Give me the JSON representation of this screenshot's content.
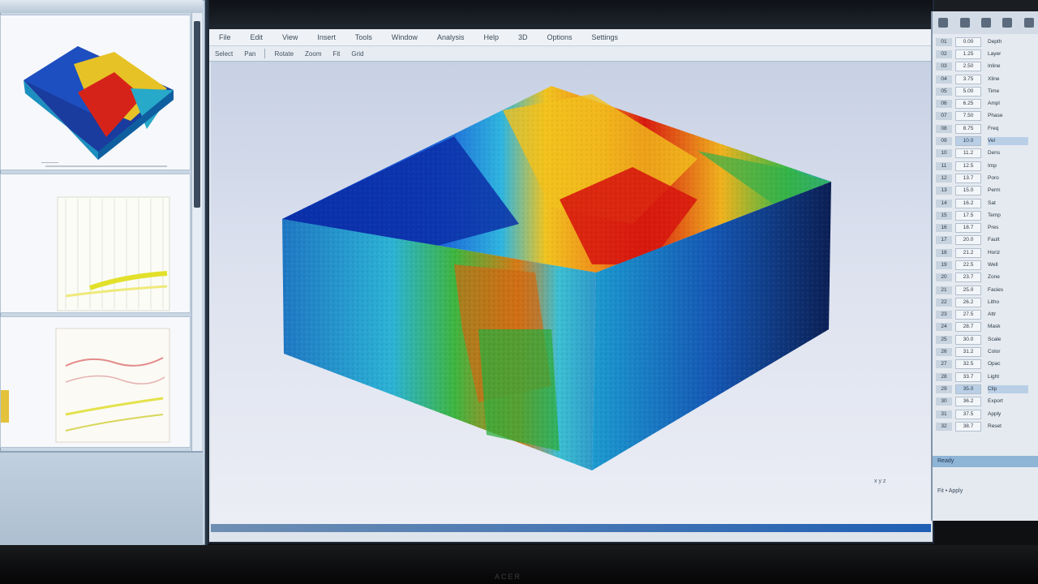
{
  "left_panel": {
    "thumb_caption": "———",
    "thumbnails": [
      {
        "name": "3d-volume-thumbnail"
      },
      {
        "name": "seismic-section-thumbnail-1"
      },
      {
        "name": "seismic-section-thumbnail-2"
      }
    ]
  },
  "main_window": {
    "menu": [
      "File",
      "Edit",
      "View",
      "Insert",
      "Tools",
      "Window",
      "Analysis",
      "Help",
      "3D",
      "Options",
      "Settings"
    ],
    "toolbar": [
      "Select",
      "Pan",
      "Rotate",
      "Zoom",
      "Fit",
      "Grid"
    ],
    "viewport_label": "x  y  z"
  },
  "right_panel": {
    "rows": [
      {
        "a": "01",
        "b": "0.00",
        "c": "Depth"
      },
      {
        "a": "02",
        "b": "1.25",
        "c": "Layer"
      },
      {
        "a": "03",
        "b": "2.50",
        "c": "Inline"
      },
      {
        "a": "04",
        "b": "3.75",
        "c": "Xline"
      },
      {
        "a": "05",
        "b": "5.00",
        "c": "Time"
      },
      {
        "a": "06",
        "b": "6.25",
        "c": "Ampl"
      },
      {
        "a": "07",
        "b": "7.50",
        "c": "Phase"
      },
      {
        "a": "08",
        "b": "8.75",
        "c": "Freq"
      },
      {
        "a": "09",
        "b": "10.0",
        "c": "Vel",
        "highlight": true
      },
      {
        "a": "10",
        "b": "11.2",
        "c": "Dens"
      },
      {
        "a": "11",
        "b": "12.5",
        "c": "Imp"
      },
      {
        "a": "12",
        "b": "13.7",
        "c": "Poro"
      },
      {
        "a": "13",
        "b": "15.0",
        "c": "Perm"
      },
      {
        "a": "14",
        "b": "16.2",
        "c": "Sat"
      },
      {
        "a": "15",
        "b": "17.5",
        "c": "Temp"
      },
      {
        "a": "16",
        "b": "18.7",
        "c": "Pres"
      },
      {
        "a": "17",
        "b": "20.0",
        "c": "Fault"
      },
      {
        "a": "18",
        "b": "21.2",
        "c": "Horiz"
      },
      {
        "a": "19",
        "b": "22.5",
        "c": "Well"
      },
      {
        "a": "20",
        "b": "23.7",
        "c": "Zone"
      },
      {
        "a": "21",
        "b": "25.0",
        "c": "Facies"
      },
      {
        "a": "22",
        "b": "26.2",
        "c": "Litho"
      },
      {
        "a": "23",
        "b": "27.5",
        "c": "Attr"
      },
      {
        "a": "24",
        "b": "28.7",
        "c": "Mask"
      },
      {
        "a": "25",
        "b": "30.0",
        "c": "Scale"
      },
      {
        "a": "26",
        "b": "31.2",
        "c": "Color"
      },
      {
        "a": "27",
        "b": "32.5",
        "c": "Opac"
      },
      {
        "a": "28",
        "b": "33.7",
        "c": "Light"
      },
      {
        "a": "29",
        "b": "35.0",
        "c": "Clip",
        "highlight": true
      },
      {
        "a": "30",
        "b": "36.2",
        "c": "Export"
      },
      {
        "a": "31",
        "b": "37.5",
        "c": "Apply"
      },
      {
        "a": "32",
        "b": "38.7",
        "c": "Reset"
      }
    ],
    "status": "Ready",
    "footer": "Fit  •  Apply"
  },
  "colors": {
    "accent": "#1f5fb4",
    "volume_hot": "#d81b10",
    "volume_cold": "#0a2fb0"
  },
  "brand": "ACER"
}
